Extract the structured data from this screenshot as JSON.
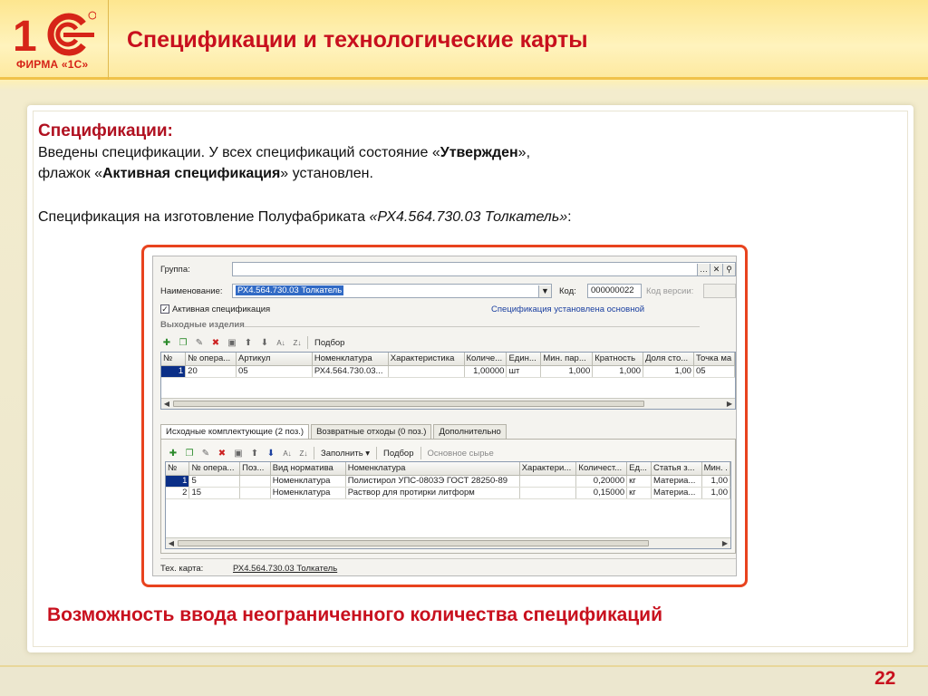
{
  "header": {
    "logo_text": "ФИРМА «1С»",
    "title": "Спецификации и технологические карты"
  },
  "slide": {
    "heading": "Спецификации:",
    "line1_pre": "Введены спецификации. У всех спецификаций состояние «",
    "line1_bold": "Утвержден",
    "line1_post": "»,",
    "line2_pre": "флажок «",
    "line2_bold": "Активная спецификация",
    "line2_post": "» установлен.",
    "line3_pre": "Спецификация на изготовление Полуфабриката  ",
    "line3_italic": "«РХ4.564.730.03 Толкатель»",
    "line3_post": ":",
    "bottom_title": "Возможность ввода неограниченного количества спецификаций",
    "page_number": "22"
  },
  "form": {
    "group_label": "Группа:",
    "group_value": "",
    "name_label": "Наименование:",
    "name_value": "РХ4.564.730.03 Толкатель",
    "code_label": "Код:",
    "code_value": "000000022",
    "version_label": "Код версии:",
    "version_value": "",
    "active_checkbox_label": "Активная спецификация",
    "active_checked": true,
    "status_link": "Спецификация установлена основной",
    "output_section": "Выходные изделия",
    "toolbar1_select": "Подбор",
    "output_table": {
      "headers": [
        "№",
        "№ опера...",
        "Артикул",
        "Номенклатура",
        "Характеристика",
        "Количе...",
        "Един...",
        "Мин. пар...",
        "Кратность",
        "Доля сто...",
        "Точка ма"
      ],
      "rows": [
        [
          "1",
          "20",
          "05",
          "РХ4.564.730.03...",
          "",
          "1,00000",
          "шт",
          "1,000",
          "1,000",
          "1,00",
          "05"
        ]
      ]
    },
    "tabs": [
      "Исходные комплектующие (2 поз.)",
      "Возвратные отходы (0 поз.)",
      "Дополнительно"
    ],
    "toolbar2_fill": "Заполнить ▾",
    "toolbar2_select": "Подбор",
    "toolbar2_raw": "Основное сырье",
    "input_table": {
      "headers": [
        "№",
        "№ опера...",
        "Поз...",
        "Вид норматива",
        "Номенклатура",
        "Характери...",
        "Количест...",
        "Ед...",
        "Статья з...",
        "Мин. ."
      ],
      "rows": [
        [
          "1",
          "5",
          "",
          "Номенклатура",
          "Полистирол УПС-0803Э ГОСТ 28250-89",
          "",
          "0,20000",
          "кг",
          "Материа...",
          "1,00"
        ],
        [
          "2",
          "15",
          "",
          "Номенклатура",
          "Раствор для протирки литформ",
          "",
          "0,15000",
          "кг",
          "Материа...",
          "1,00"
        ]
      ]
    },
    "techcard_label": "Тех. карта:",
    "techcard_link": "РХ4.564.730.03 Толкатель"
  },
  "colors": {
    "accent_red": "#c8101e",
    "frame_orange": "#e8431e",
    "selection_blue": "#0b2f87",
    "link_blue": "#1a3fa0"
  },
  "icons": {
    "toolbar": [
      "add-icon",
      "copy-icon",
      "edit-icon",
      "delete-icon",
      "post-icon",
      "arrow-up-icon",
      "arrow-down-icon",
      "sort-asc-icon",
      "sort-desc-icon"
    ]
  }
}
